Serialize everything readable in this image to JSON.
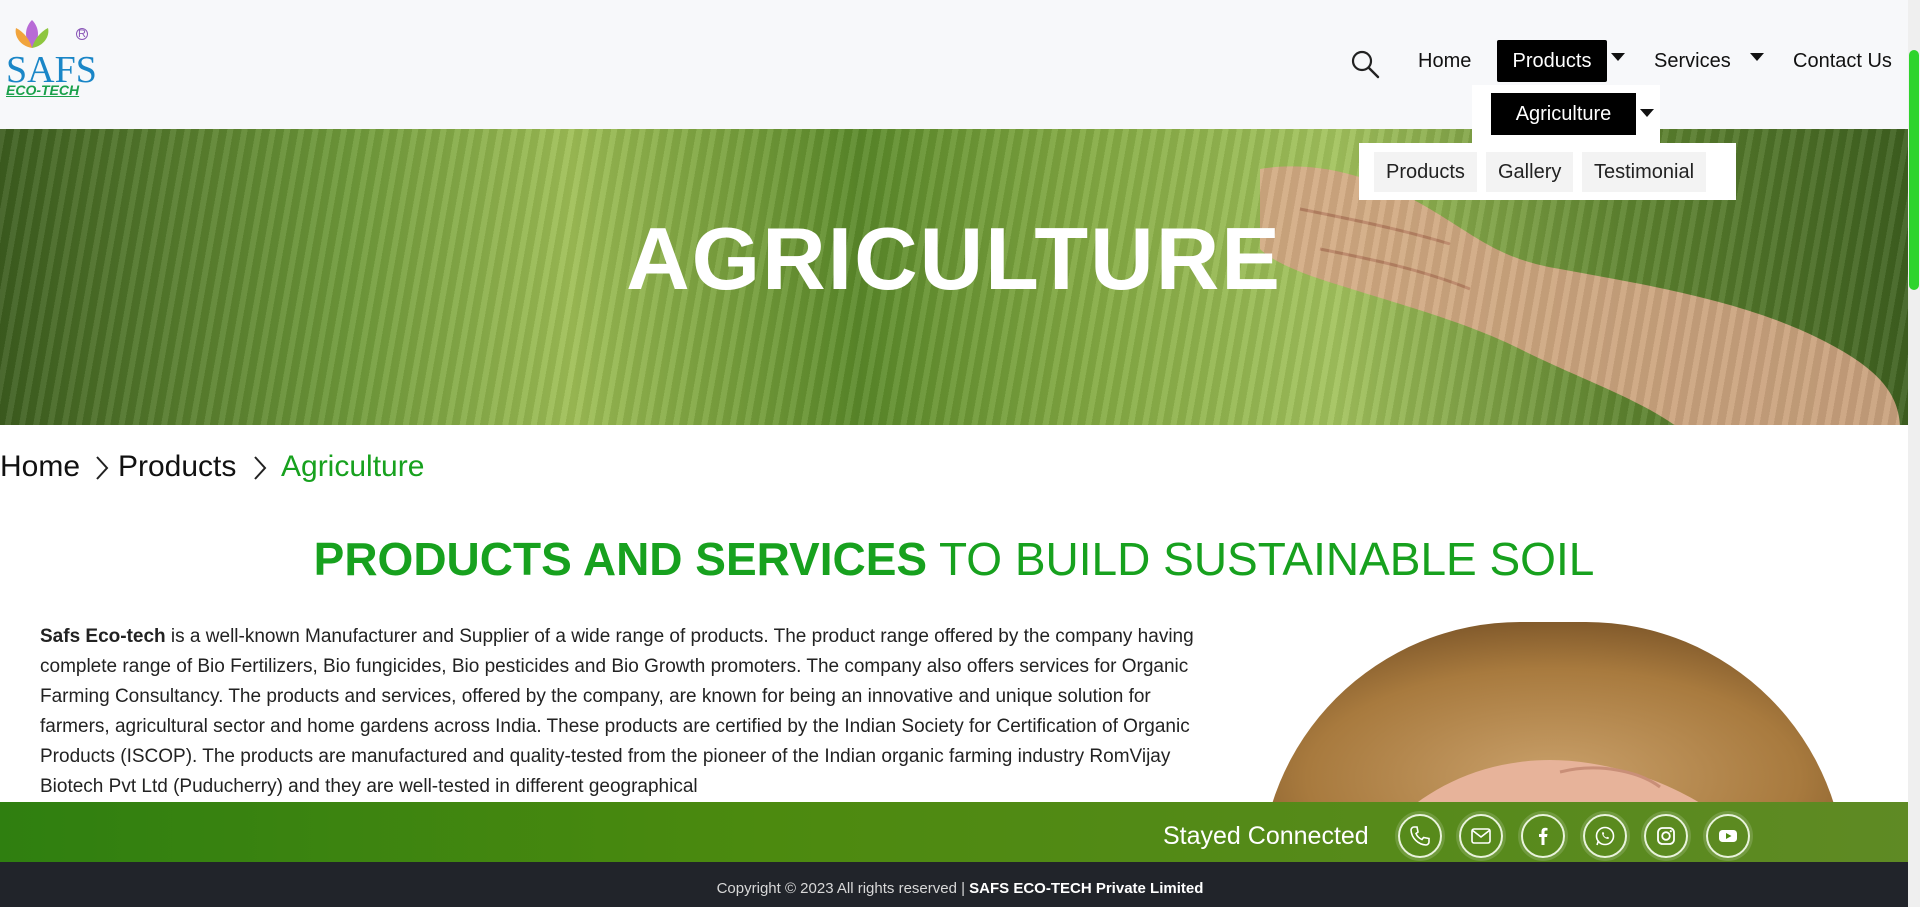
{
  "header": {
    "logo_text": "SAFS",
    "logo_subtext": "ECO-TECH",
    "logo_reg": "R",
    "nav": {
      "home": "Home",
      "products": "Products",
      "services": "Services",
      "contact": "Contact Us"
    },
    "dropdown": {
      "agriculture": "Agriculture",
      "submenu": [
        "Products",
        "Gallery",
        "Testimonial"
      ]
    }
  },
  "banner": {
    "title": "AGRICULTURE"
  },
  "breadcrumb": {
    "home": "Home",
    "products": "Products",
    "current": "Agriculture"
  },
  "section": {
    "heading_bold": "PRODUCTS AND SERVICES",
    "heading_rest": " TO BUILD SUSTAINABLE SOIL",
    "company_name": "Safs Eco-tech",
    "body": " is a well-known Manufacturer and Supplier of a wide range of products. The product range offered by the company having complete range of Bio Fertilizers, Bio fungicides, Bio pesticides and Bio Growth promoters. The company also offers services for Organic Farming Consultancy. The products and services, offered by the company, are known for being an innovative and unique solution for farmers, agricultural sector and home gardens across India. These products are certified by the Indian Society for Certification of Organic Products (ISCOP). The products are manufactured and quality-tested from the pioneer of the Indian organic farming industry RomVijay Biotech Pvt Ltd (Puducherry) and they are well-tested in different geographical"
  },
  "connect": {
    "label": "Stayed Connected",
    "icons": [
      "phone-icon",
      "mail-icon",
      "facebook-icon",
      "whatsapp-icon",
      "instagram-icon",
      "youtube-icon"
    ]
  },
  "footer": {
    "copyright": "Copyright © 2023 All rights reserved | ",
    "company": "SAFS ECO-TECH Private Limited"
  },
  "colors": {
    "brand_green": "#17a11e",
    "nav_active_bg": "#000000",
    "footer_bg": "#21242a",
    "scroll_thumb": "#2ed42c"
  }
}
